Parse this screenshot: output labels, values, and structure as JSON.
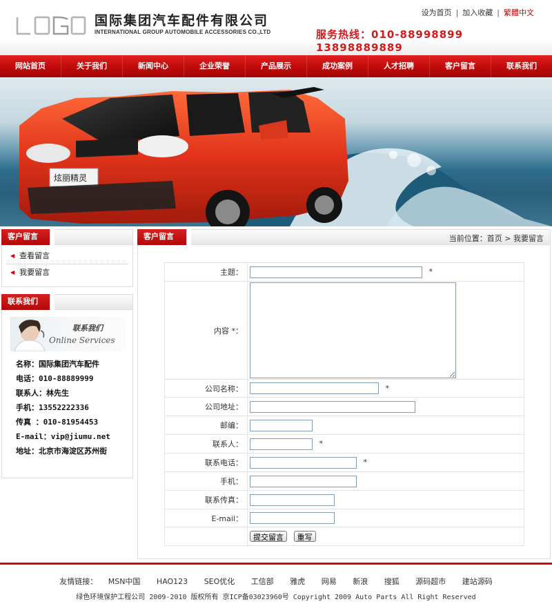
{
  "header": {
    "logo_text": "LOGO",
    "company_cn": "国际集团汽车配件有限公司",
    "company_en": "INTERNATIONAL GROUP AUTOMOBILE ACCESSORIES CO.,LTD",
    "toplinks": {
      "homepage": "设为首页",
      "bookmark": "加入收藏",
      "traditional": "繁體中文"
    },
    "hotline": "服务热线：010-88998899  13898889889"
  },
  "nav": {
    "items": [
      "网站首页",
      "关于我们",
      "新闻中心",
      "企业荣誉",
      "产品展示",
      "成功案例",
      "人才招聘",
      "客户留言",
      "联系我们"
    ]
  },
  "banner": {
    "car_badge": "炫丽精灵"
  },
  "sidebar": {
    "messages": {
      "title": "客户留言",
      "items": [
        "查看留言",
        "我要留言"
      ]
    },
    "contact": {
      "title": "联系我们",
      "online_cn": "联系我们",
      "online_en": "Online Services",
      "lines": [
        "名称：国际集团汽车配件",
        "电话：010-88889999",
        "联系人：林先生",
        "手机：13552222336",
        "传真 ：010-81954453",
        "E-mail：vip@jiumu.net",
        "地址：北京市海淀区苏州街"
      ]
    }
  },
  "main": {
    "title": "客户留言",
    "breadcrumb": "当前位置：首页 > 我要留言",
    "form": {
      "subject_label": "主题：",
      "content_label": "内容 *：",
      "company_label": "公司名称：",
      "address_label": "公司地址：",
      "zip_label": "邮编：",
      "contact_label": "联系人：",
      "phone_label": "联系电话：",
      "mobile_label": "手机：",
      "fax_label": "联系传真：",
      "email_label": "E-mail：",
      "required_mark": "*",
      "submit_label": "提交留言",
      "reset_label": "重写"
    }
  },
  "footer": {
    "links_label": "友情链接：",
    "links": [
      "MSN中国",
      "HAO123",
      "SEO优化",
      "工信部",
      "雅虎",
      "网易",
      "新浪",
      "搜狐",
      "源码超市",
      "建站源码"
    ],
    "copyright": "绿色环境保护工程公司 2009-2010 版权所有 京ICP备03023960号 Copyright 2009 Auto Parts All Right Reserved"
  },
  "colors": {
    "brand_red": "#c00a0a",
    "hotline_red": "#d31b1b",
    "input_border": "#7f9db9"
  }
}
